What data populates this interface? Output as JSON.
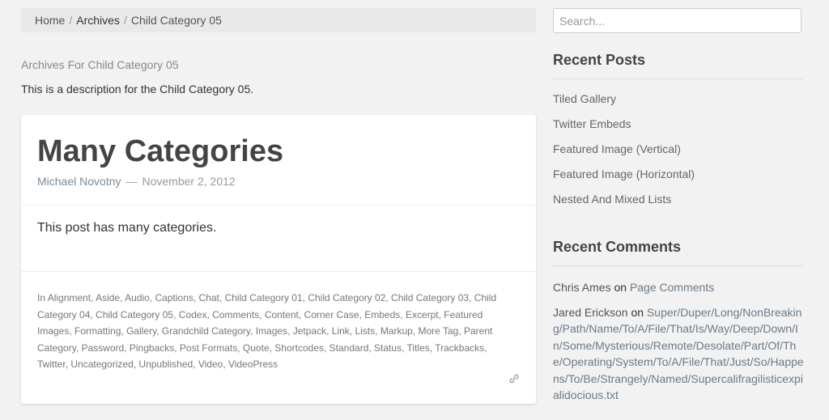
{
  "breadcrumb": {
    "home": "Home",
    "sep": "/",
    "archives": "Archives",
    "sep2": "/",
    "current": "Child Category 05"
  },
  "archive": {
    "title": "Archives For Child Category 05",
    "description": "This is a description for the Child Category 05."
  },
  "post": {
    "title": "Many Categories",
    "author": "Michael Novotny",
    "dash": "—",
    "date": "November 2, 2012",
    "content": "This post has many categories.",
    "categories_prefix": "In",
    "categories": [
      "Alignment",
      "Aside",
      "Audio",
      "Captions",
      "Chat",
      "Child Category 01",
      "Child Category 02",
      "Child Category 03",
      "Child Category 04",
      "Child Category 05",
      "Codex",
      "Comments",
      "Content",
      "Corner Case",
      "Embeds",
      "Excerpt",
      "Featured Images",
      "Formatting",
      "Gallery",
      "Grandchild Category",
      "Images",
      "Jetpack",
      "Link",
      "Lists",
      "Markup",
      "More Tag",
      "Parent Category",
      "Password",
      "Pingbacks",
      "Post Formats",
      "Quote",
      "Shortcodes",
      "Standard",
      "Status",
      "Titles",
      "Trackbacks",
      "Twitter",
      "Uncategorized",
      "Unpublished",
      "Video",
      "VideoPress"
    ],
    "permalink_icon": "link-icon"
  },
  "sidebar": {
    "search_placeholder": "Search...",
    "recent_posts_title": "Recent Posts",
    "recent_posts": [
      "Tiled Gallery",
      "Twitter Embeds",
      "Featured Image (Vertical)",
      "Featured Image (Horizontal)",
      "Nested And Mixed Lists"
    ],
    "recent_comments_title": "Recent Comments",
    "recent_comments": [
      {
        "author": "Chris Ames",
        "on": "on",
        "post": "Page Comments"
      },
      {
        "author": "Jared Erickson",
        "on": "on",
        "post": "Super/Duper/Long/NonBreaking/Path/Name/To/A/File/That/Is/Way/Deep/Down/In/Some/Mysterious/Remote/Desolate/Part/Of/The/Operating/System/To/A/File/That/Just/So/Happens/To/Be/Strangely/Named/Supercalifragilisticexpialidocious.txt"
      }
    ]
  }
}
